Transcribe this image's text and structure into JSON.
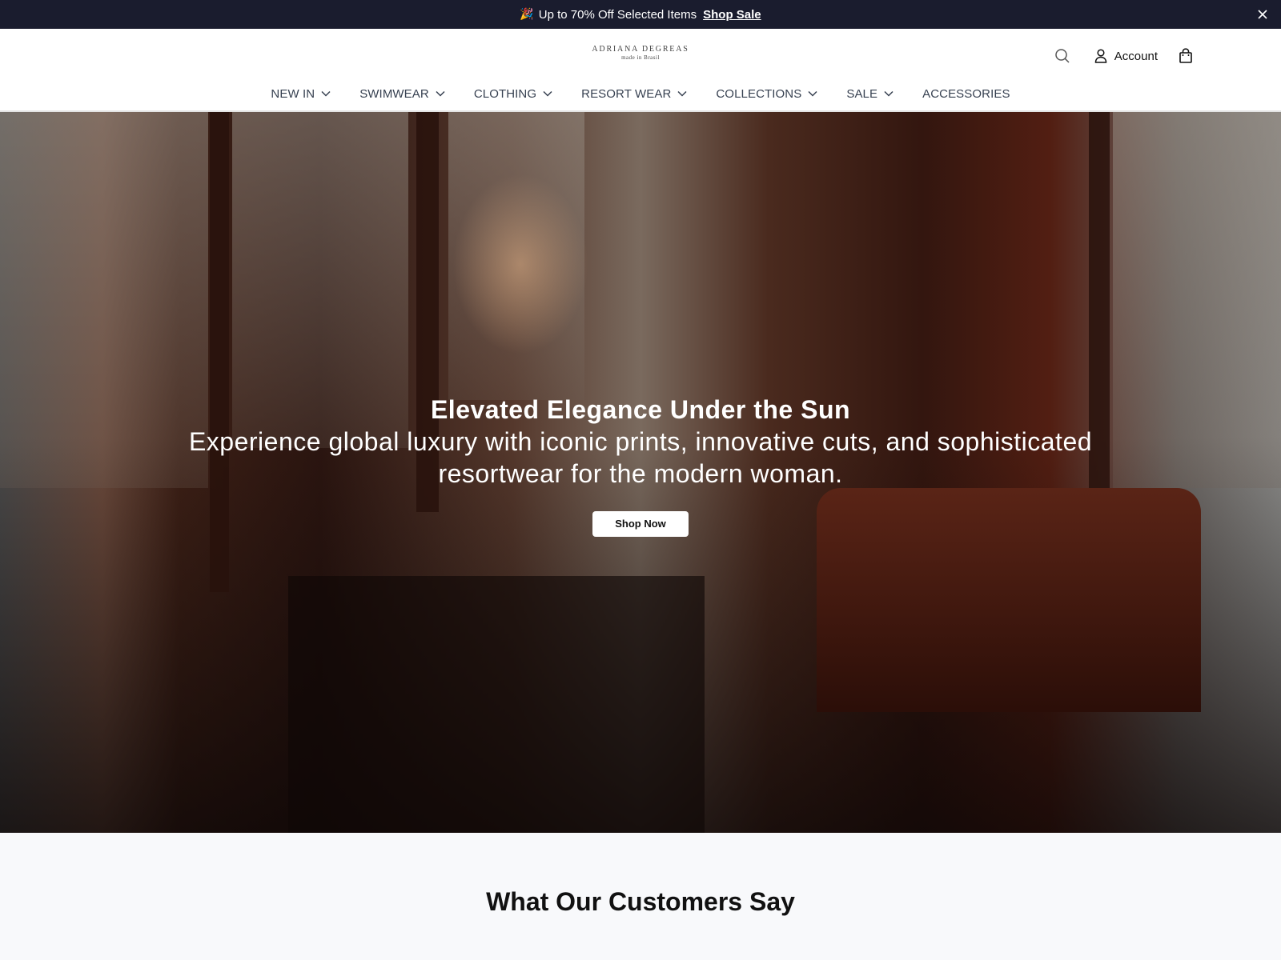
{
  "announcement": {
    "emoji": "🎉",
    "text": "Up to 70% Off Selected Items",
    "link_label": "Shop Sale",
    "close_icon": "close-icon"
  },
  "header": {
    "logo": {
      "brand": "ADRIANA DEGREAS",
      "tagline": "made in Brasil"
    },
    "search_icon": "search-icon",
    "account_label": "Account",
    "account_icon": "user-icon",
    "cart_icon": "shopping-bag-icon"
  },
  "nav": {
    "items": [
      {
        "label": "NEW IN",
        "has_dropdown": true
      },
      {
        "label": "SWIMWEAR",
        "has_dropdown": true
      },
      {
        "label": "CLOTHING",
        "has_dropdown": true
      },
      {
        "label": "RESORT WEAR",
        "has_dropdown": true
      },
      {
        "label": "COLLECTIONS",
        "has_dropdown": true
      },
      {
        "label": "SALE",
        "has_dropdown": true
      },
      {
        "label": "ACCESSORIES",
        "has_dropdown": false
      }
    ]
  },
  "hero": {
    "title": "Elevated Elegance Under the Sun",
    "subtitle": "Experience global luxury with iconic prints, innovative cuts, and sophisticated resortwear for the modern woman.",
    "cta_label": "Shop Now"
  },
  "reviews": {
    "heading": "What Our Customers Say"
  },
  "colors": {
    "announcement_bg": "#1a1c2e",
    "nav_text": "#374151",
    "page_bg": "#f8f9fb"
  }
}
